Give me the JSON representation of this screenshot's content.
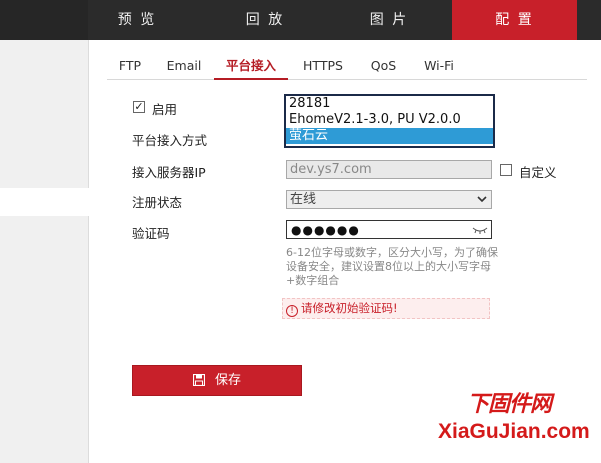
{
  "nav": {
    "items": [
      {
        "label": "预 览"
      },
      {
        "label": "回 放"
      },
      {
        "label": "图 片"
      },
      {
        "label": "配 置",
        "active": true
      }
    ]
  },
  "tabs": [
    {
      "label": "FTP"
    },
    {
      "label": "Email"
    },
    {
      "label": "平台接入",
      "active": true
    },
    {
      "label": "HTTPS"
    },
    {
      "label": "QoS"
    },
    {
      "label": "Wi-Fi"
    }
  ],
  "form": {
    "enable": {
      "label": "启用",
      "checked": true
    },
    "access_mode": {
      "label": "平台接入方式",
      "options": [
        "28181",
        "EhomeV2.1-3.0, PU V2.0.0",
        "萤石云"
      ],
      "selected": "萤石云"
    },
    "server_ip": {
      "label": "接入服务器IP",
      "value": "dev.ys7.com",
      "custom_label": "自定义"
    },
    "reg_status": {
      "label": "注册状态",
      "value": "在线"
    },
    "code": {
      "label": "验证码",
      "value": "●●●●●●"
    },
    "hint": "6-12位字母或数字，区分大小写，为了确保设备安全，建议设置8位以上的大小写字母+数字组合",
    "error": "请修改初始验证码!"
  },
  "save_label": "保存",
  "watermark": {
    "cn": "下固件网",
    "en": "XiaGuJian.com"
  },
  "colors": {
    "accent": "#c8202a",
    "nav_bg": "#2b2b2b",
    "selected_option": "#2e9bd6"
  }
}
